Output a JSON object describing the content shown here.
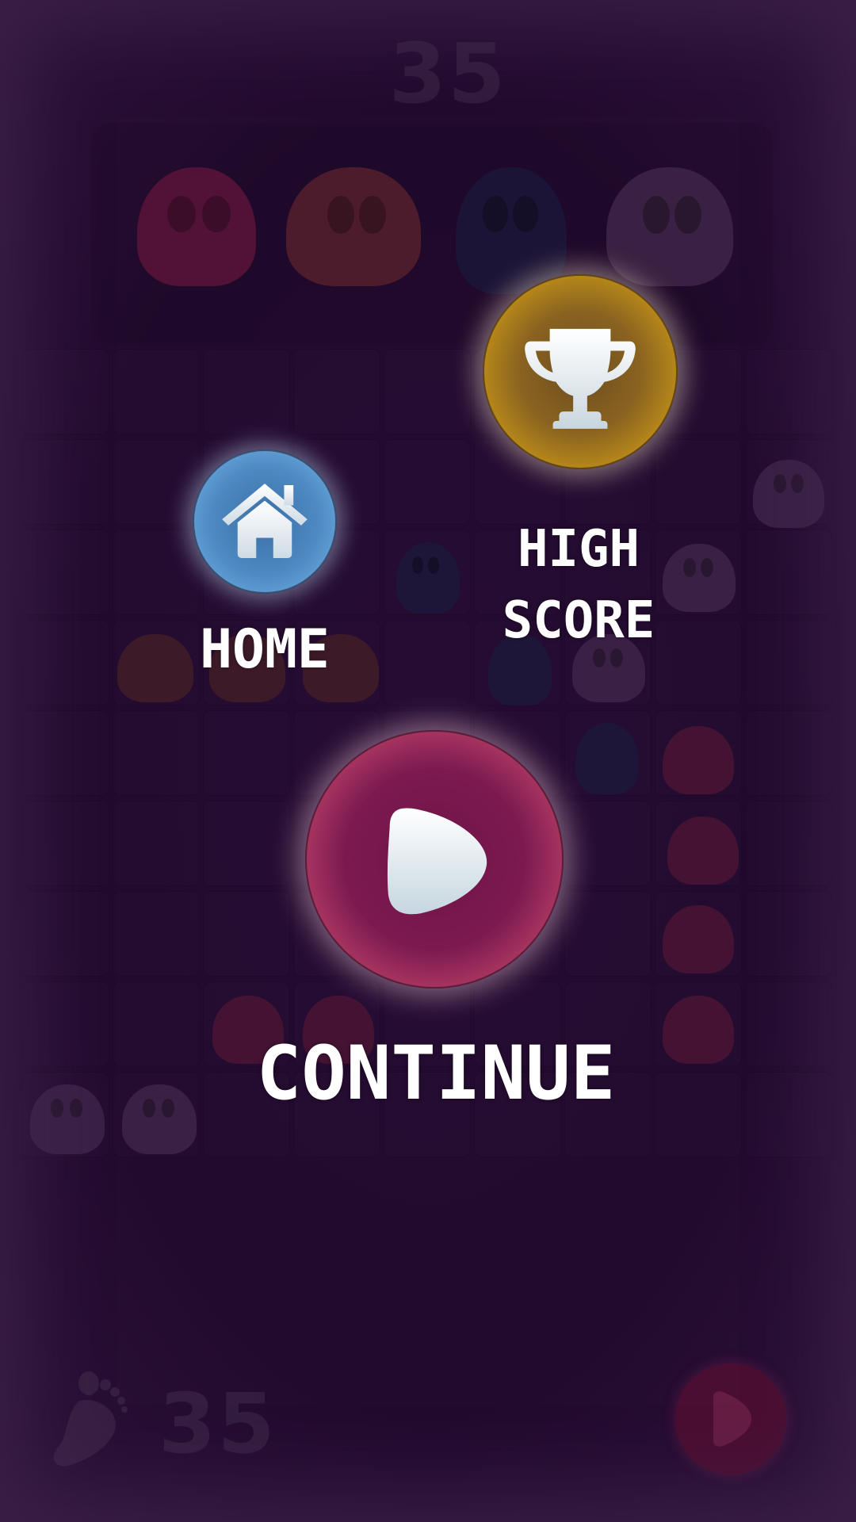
{
  "game": {
    "background_score": "35",
    "steps_count": "35"
  },
  "pause_menu": {
    "home_label": "HOME",
    "high_score_line1": "HIGH",
    "high_score_line2": "SCORE",
    "continue_label": "CONTINUE"
  },
  "colors": {
    "background": "#230a2e",
    "home_button": "#4f8ac4",
    "trophy_button": "#d8a315",
    "play_button": "#7c1a50",
    "icon": "#e9eef2"
  },
  "icons": {
    "home": "house-icon",
    "high_score": "trophy-icon",
    "continue": "play-icon",
    "steps": "footprint-icon"
  }
}
